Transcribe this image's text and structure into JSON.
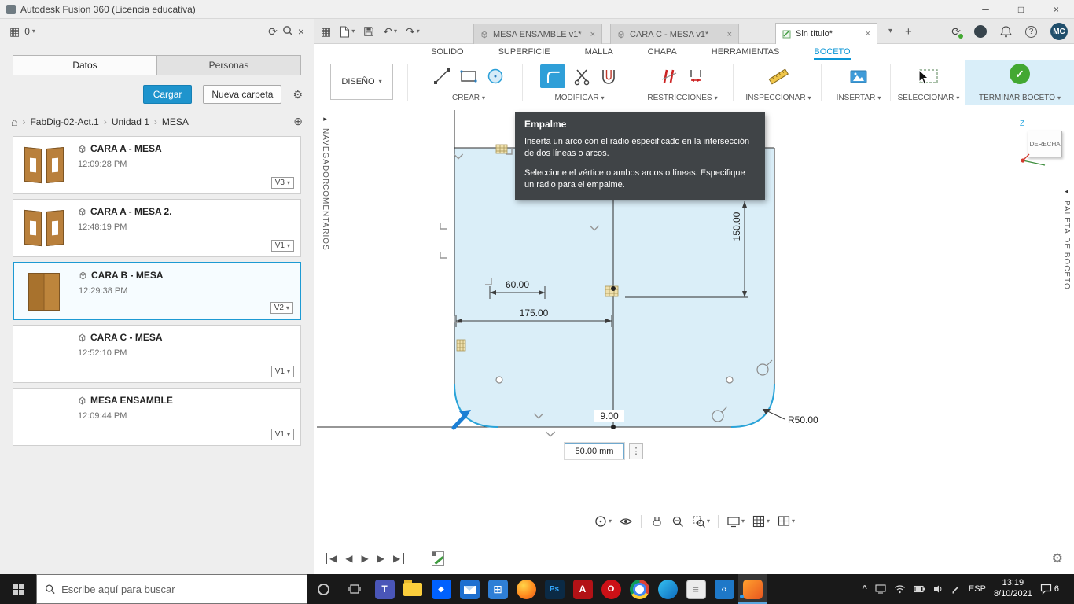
{
  "window": {
    "title": "Autodesk Fusion 360 (Licencia educativa)"
  },
  "icons": {
    "grid": "▦",
    "dropdown": "▾",
    "refresh": "⟳",
    "close": "×",
    "gear": "⚙",
    "home": "⌂",
    "sep": "›",
    "globe": "⊕",
    "undo": "↶",
    "redo": "↷",
    "plus": "+",
    "help": "?",
    "check": "✓",
    "kebab": "⋮",
    "expand_right": "▸",
    "expand_left": "◂",
    "minimize": "─",
    "maximize": "□",
    "chevron_up": "^",
    "back": "◀",
    "play": "▶"
  },
  "data_panel": {
    "job_count": "0",
    "tabs": {
      "datos": "Datos",
      "personas": "Personas"
    },
    "actions": {
      "upload": "Cargar",
      "new_folder": "Nueva carpeta"
    },
    "breadcrumb": {
      "root": "FabDig-02-Act.1",
      "level1": "Unidad 1",
      "level2": "MESA"
    },
    "items": [
      {
        "name": "CARA A - MESA",
        "time": "12:09:28 PM",
        "version": "V3"
      },
      {
        "name": "CARA A - MESA 2.",
        "time": "12:48:19 PM",
        "version": "V1"
      },
      {
        "name": "CARA B - MESA",
        "time": "12:29:38 PM",
        "version": "V2"
      },
      {
        "name": "CARA C - MESA",
        "time": "12:52:10 PM",
        "version": "V1"
      },
      {
        "name": "MESA ENSAMBLE",
        "time": "12:09:44 PM",
        "version": "V1"
      }
    ]
  },
  "doc_tabs": {
    "tab1": "MESA ENSAMBLE v1*",
    "tab2": "CARA C - MESA v1*",
    "tab3": "Sin título*"
  },
  "account": {
    "avatar": "MC"
  },
  "ribbon": {
    "workspace": "DISEÑO",
    "tab_solido": "SOLIDO",
    "tab_superficie": "SUPERFICIE",
    "tab_malla": "MALLA",
    "tab_chapa": "CHAPA",
    "tab_herramientas": "HERRAMIENTAS",
    "tab_boceto": "BOCETO",
    "group_crear": "CREAR",
    "group_modificar": "MODIFICAR",
    "group_restricciones": "RESTRICCIONES",
    "group_inspeccionar": "INSPECCIONAR",
    "group_insertar": "INSERTAR",
    "group_seleccionar": "SELECCIONAR",
    "finish": "TERMINAR BOCETO"
  },
  "panels": {
    "navegador": "NAVEGADOR",
    "comentarios": "COMENTARIOS",
    "paleta": "PALETA DE BOCETO"
  },
  "viewcube": {
    "face": "DERECHA",
    "axis_z": "Z"
  },
  "tooltip": {
    "title": "Empalme",
    "p1": "Inserta un arco con el radio especificado en la intersección de dos líneas o arcos.",
    "p2": "Seleccione el vértice o ambos arcos o líneas. Especifique un radio para el empalme."
  },
  "sketch": {
    "dim_height": "150.00",
    "dim_inner": "60.00",
    "dim_width": "175.00",
    "dim_offset": "9.00",
    "dim_radius": "R50.00",
    "input_value": "50.00 mm"
  },
  "taskbar": {
    "search_placeholder": "Escribe aquí para buscar",
    "lang": "ESP",
    "time": "13:19",
    "date": "8/10/2021",
    "badge": "6"
  },
  "colors": {
    "accent_blue": "#0a96d6",
    "finish_green": "#43a832",
    "selection_blue": "#1d9ad3"
  }
}
